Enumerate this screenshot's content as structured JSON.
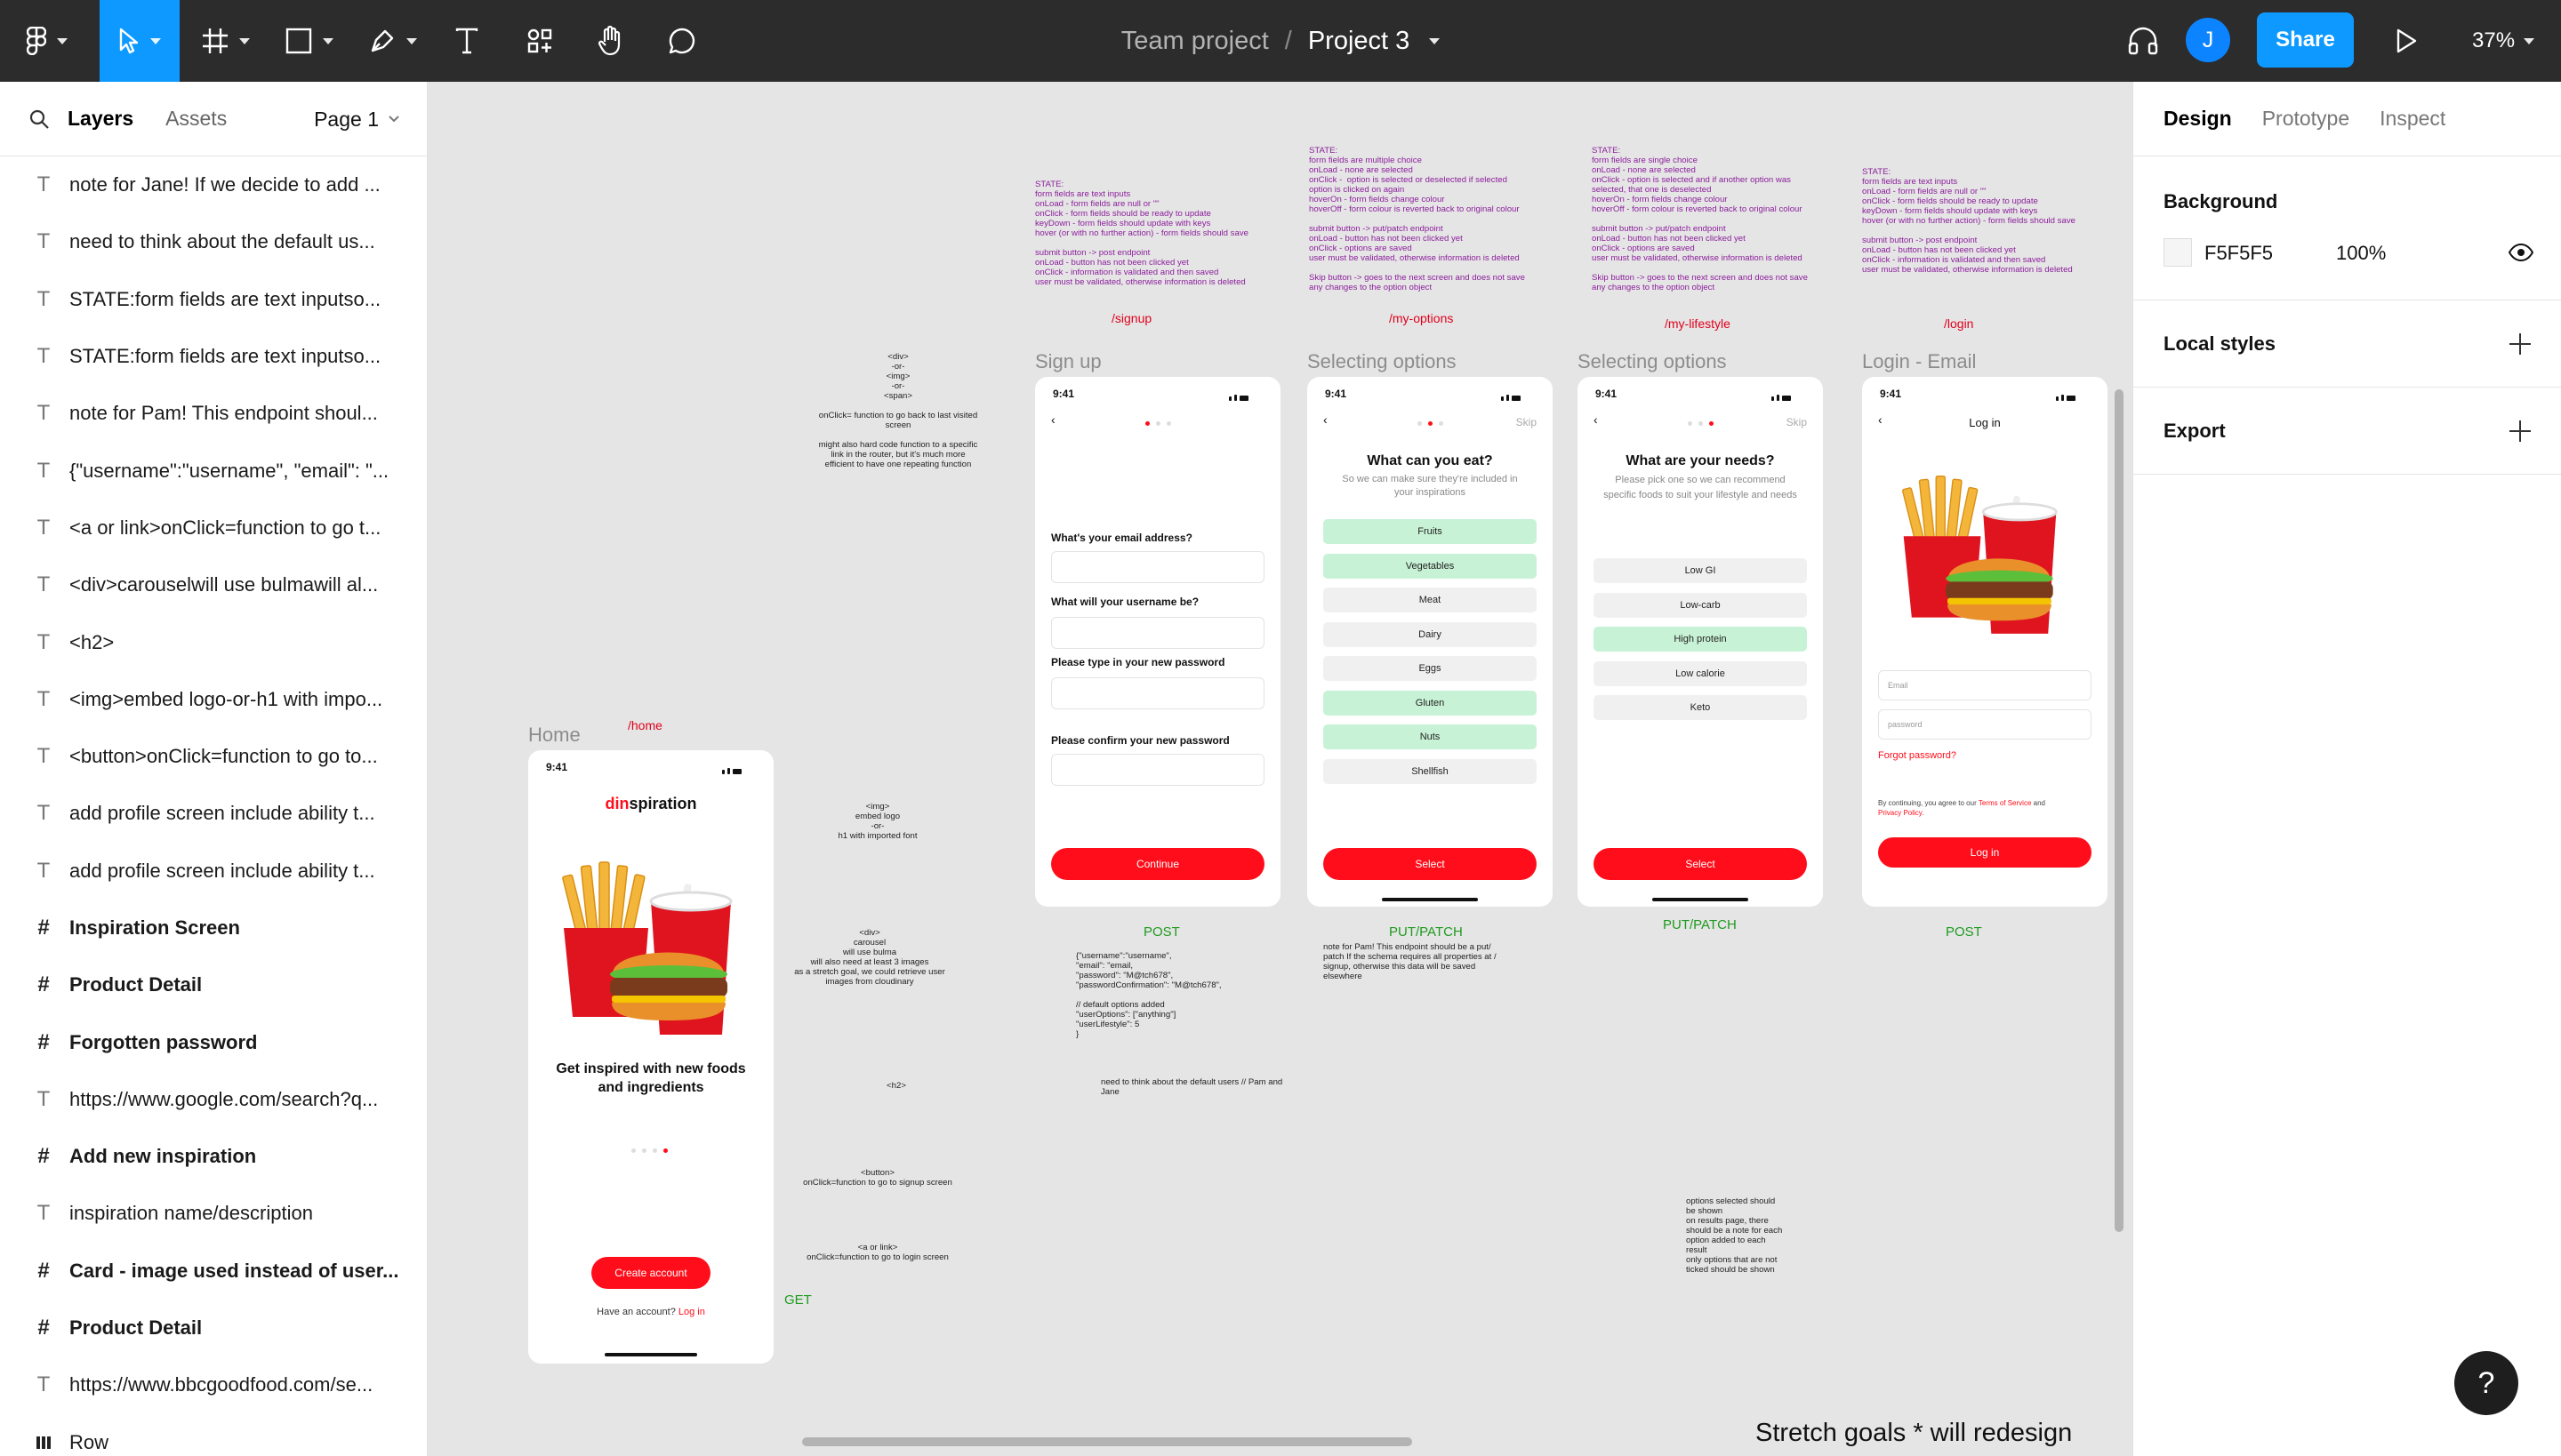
{
  "toolbar": {
    "breadcrumb_team": "Team project",
    "breadcrumb_sep": "/",
    "project_name": "Project 3",
    "avatar_initial": "J",
    "share_label": "Share",
    "zoom": "37%"
  },
  "left_panel": {
    "tab_layers": "Layers",
    "tab_assets": "Assets",
    "page": "Page 1",
    "layers": [
      {
        "type": "text",
        "label": "note for Jane! If we decide to add ..."
      },
      {
        "type": "text",
        "label": "need to think about the default us..."
      },
      {
        "type": "text",
        "label": "STATE:form fields are text inputso..."
      },
      {
        "type": "text",
        "label": "STATE:form fields are text inputso..."
      },
      {
        "type": "text",
        "label": "note for Pam! This endpoint shoul..."
      },
      {
        "type": "text",
        "label": "{\"username\":\"username\", \"email\": \"..."
      },
      {
        "type": "text",
        "label": "<a or link>onClick=function to go t..."
      },
      {
        "type": "text",
        "label": "<div>carouselwill use bulmawill al..."
      },
      {
        "type": "text",
        "label": "<h2>"
      },
      {
        "type": "text",
        "label": "<img>embed logo-or-h1 with impo..."
      },
      {
        "type": "text",
        "label": "<button>onClick=function to go to..."
      },
      {
        "type": "text",
        "label": "add profile screen include ability t..."
      },
      {
        "type": "text",
        "label": "add profile screen include ability t..."
      },
      {
        "type": "frame",
        "label": "Inspiration Screen"
      },
      {
        "type": "frame",
        "label": "Product Detail"
      },
      {
        "type": "frame",
        "label": "Forgotten password"
      },
      {
        "type": "text",
        "label": "https://www.google.com/search?q..."
      },
      {
        "type": "frame",
        "label": "Add new inspiration"
      },
      {
        "type": "text",
        "label": "inspiration name/description"
      },
      {
        "type": "frame",
        "label": "Card - image used instead of user..."
      },
      {
        "type": "frame",
        "label": "Product Detail"
      },
      {
        "type": "text",
        "label": "https://www.bbcgoodfood.com/se..."
      },
      {
        "type": "row",
        "label": "Row"
      }
    ]
  },
  "right_panel": {
    "tab_design": "Design",
    "tab_prototype": "Prototype",
    "tab_inspect": "Inspect",
    "background_title": "Background",
    "background_hex": "F5F5F5",
    "background_color": "#F5F5F5",
    "background_opacity": "100%",
    "local_styles": "Local styles",
    "export": "Export",
    "help": "?"
  },
  "canvas": {
    "home": {
      "frame_label": "Home",
      "route": "/home",
      "time": "9:41",
      "logo_red": "din",
      "logo_black": "spiration",
      "headline": "Get inspired with new foods and ingredients",
      "cta": "Create account",
      "have_account": "Have an account?",
      "login_link": "Log in",
      "method": "GET"
    },
    "home_notes": {
      "div_note": "<div>\n-or-\n<img>\n-or-\n<span>\n\nonClick= function to go back to last visited\nscreen\n\nmight also hard code function to a specific\nlink in the router, but it's much more\nefficient to have one repeating function",
      "img_note": "<img>\nembed logo\n-or-\nh1 with imported font",
      "carousel_note": "<div>\ncarousel\nwill use bulma\nwill also need at least 3 images\nas a stretch goal, we could retrieve user\nimages from cloudinary",
      "h2_note": "<h2>",
      "button_note": "<button>\nonClick=function to go to signup screen",
      "link_note": "<a or link>\nonClick=function to go to login screen"
    },
    "signup": {
      "state_note": "STATE:\nform fields are text inputs\nonLoad - form fields are null or \"\"\nonClick - form fields should be ready to update\nkeyDown - form fields should update with keys\nhover (or with no further action) - form fields should save\n\nsubmit button -> post endpoint\nonLoad - button has not been clicked yet\nonClick - information is validated and then saved\nuser must be validated, otherwise information is deleted",
      "route": "/signup",
      "frame_label": "Sign up",
      "time": "9:41",
      "q1": "What's your email address?",
      "q2": "What will your username be?",
      "q3": "Please type in your new password",
      "q4": "Please confirm your new password",
      "button": "Continue",
      "method": "POST",
      "json_note": "{\"username\":\"username\",\n\"email\": \"email,\n\"password\": \"M@tch678\",\n\"passwordConfirmation\": \"M@tch678\",\n\n// default options added\n\"userOptions\": [\"anything\"]\n\"userLifestyle\": 5\n}",
      "default_note": "need to think about the default users // Pam and\nJane"
    },
    "my_options": {
      "state_note": "STATE:\nform fields are multiple choice\nonLoad - none are selected\nonClick -  option is selected or deselected if selected\noption is clicked on again\nhoverOn - form fields change colour\nhoverOff - form colour is reverted back to original colour\n\nsubmit button -> put/patch endpoint\nonLoad - button has not been clicked yet\nonClick - options are saved\nuser must be validated, otherwise information is deleted\n\nSkip button -> goes to the next screen and does not save\nany changes to the option object",
      "route": "/my-options",
      "frame_label": "Selecting options",
      "time": "9:41",
      "skip": "Skip",
      "title": "What can you eat?",
      "subtitle": "So we can make sure they're included in your inspirations",
      "options": [
        {
          "label": "Fruits",
          "selected": true
        },
        {
          "label": "Vegetables",
          "selected": true
        },
        {
          "label": "Meat",
          "selected": false
        },
        {
          "label": "Dairy",
          "selected": false
        },
        {
          "label": "Eggs",
          "selected": false
        },
        {
          "label": "Gluten",
          "selected": true
        },
        {
          "label": "Nuts",
          "selected": true
        },
        {
          "label": "Shellfish",
          "selected": false
        }
      ],
      "button": "Select",
      "method": "PUT/PATCH",
      "pam_note": "note for Pam! This endpoint should be a put/\npatch If the schema requires all properties at /\nsignup, otherwise this data will be saved\nelsewhere"
    },
    "my_lifestyle": {
      "state_note": "STATE:\nform fields are single choice\nonLoad - none are selected\nonClick - option is selected and if another option was\nselected, that one is deselected\nhoverOn - form fields change colour\nhoverOff - form colour is reverted back to original colour\n\nsubmit button -> put/patch endpoint\nonLoad - button has not been clicked yet\nonClick - options are saved\nuser must be validated, otherwise information is deleted\n\nSkip button -> goes to the next screen and does not save\nany changes to the option object",
      "route": "/my-lifestyle",
      "frame_label": "Selecting options",
      "time": "9:41",
      "skip": "Skip",
      "title": "What are your needs?",
      "subtitle": "Please pick one so we can recommend specific foods to suit your lifestyle and needs",
      "options": [
        {
          "label": "Low GI",
          "selected": false
        },
        {
          "label": "Low-carb",
          "selected": false
        },
        {
          "label": "High protein",
          "selected": true
        },
        {
          "label": "Low calorie",
          "selected": false
        },
        {
          "label": "Keto",
          "selected": false
        }
      ],
      "button": "Select",
      "method": "PUT/PATCH",
      "bullet_note": "options selected should\nbe shown\non results page, there\nshould be a note for each\noption added to each\nresult\nonly options that are not\nticked should be shown"
    },
    "login": {
      "state_note": "STATE:\nform fields are text inputs\nonLoad - form fields are null or \"\"\nonClick - form fields should be ready to update\nkeyDown - form fields should update with keys\nhover (or with no further action) - form fields should save\n\nsubmit button -> post endpoint\nonLoad - button has not been clicked yet\nonClick - information is validated and then saved\nuser must be validated, otherwise information is deleted",
      "route": "/login",
      "frame_label": "Login - Email",
      "time": "9:41",
      "title": "Log in",
      "email_placeholder": "Email",
      "password_placeholder": "password",
      "forgot": "Forgot password?",
      "terms_prefix": "By continuing, you agree to our",
      "terms_link": "Terms of Service",
      "terms_and": "and",
      "privacy_link": "Privacy Policy.",
      "button": "Log in",
      "method": "POST"
    },
    "stretch_goals": "Stretch goals * will redesign"
  }
}
